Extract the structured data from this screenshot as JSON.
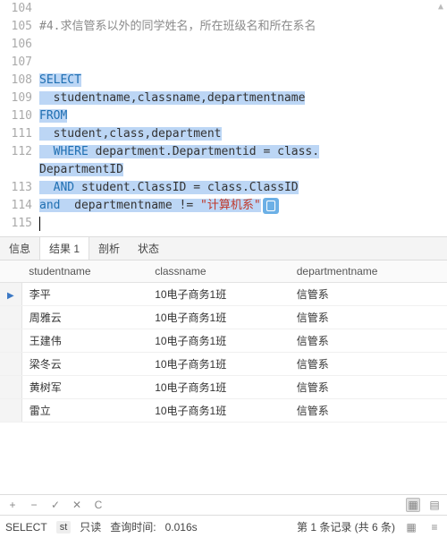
{
  "editor": {
    "lines": [
      {
        "num": "104",
        "tokens": []
      },
      {
        "num": "105",
        "tokens": [
          {
            "t": "#4.求信管系以外的同学姓名，所在班级名和所在系名",
            "cls": "comment"
          }
        ]
      },
      {
        "num": "106",
        "tokens": []
      },
      {
        "num": "107",
        "tokens": []
      },
      {
        "num": "108",
        "tokens": [
          {
            "t": "SELECT",
            "cls": "kw sel"
          }
        ]
      },
      {
        "num": "109",
        "tokens": [
          {
            "t": "  ",
            "cls": "sel"
          },
          {
            "t": "studentname,classname,departmentname",
            "cls": "sel"
          }
        ]
      },
      {
        "num": "110",
        "tokens": [
          {
            "t": "FROM",
            "cls": "kw sel"
          }
        ]
      },
      {
        "num": "111",
        "tokens": [
          {
            "t": "  ",
            "cls": "sel"
          },
          {
            "t": "student,class,department",
            "cls": "sel"
          }
        ]
      },
      {
        "num": "112",
        "tokens": [
          {
            "t": "  ",
            "cls": "sel"
          },
          {
            "t": "WHERE",
            "cls": "kw sel"
          },
          {
            "t": " department.Departmentid = class.",
            "cls": "sel"
          }
        ],
        "cont": [
          {
            "t": "DepartmentID",
            "cls": "sel"
          }
        ]
      },
      {
        "num": "113",
        "tokens": [
          {
            "t": "  ",
            "cls": "sel"
          },
          {
            "t": "AND",
            "cls": "kw sel"
          },
          {
            "t": " student.ClassID = class.ClassID",
            "cls": "sel"
          }
        ]
      },
      {
        "num": "114",
        "tokens": [
          {
            "t": "and",
            "cls": "kw sel"
          },
          {
            "t": "  departmentname != ",
            "cls": "sel"
          },
          {
            "t": "\"计算机系\"",
            "cls": "str sel"
          }
        ],
        "badge": true
      },
      {
        "num": "115",
        "tokens": [],
        "cursor": true
      }
    ]
  },
  "tabs": {
    "items": [
      "信息",
      "结果 1",
      "剖析",
      "状态"
    ],
    "active": 1
  },
  "grid": {
    "columns": [
      "studentname",
      "classname",
      "departmentname"
    ],
    "rows": [
      {
        "marker": "▶",
        "cells": [
          "李平",
          "10电子商务1班",
          "信管系"
        ]
      },
      {
        "marker": "",
        "cells": [
          "周雅云",
          "10电子商务1班",
          "信管系"
        ]
      },
      {
        "marker": "",
        "cells": [
          "王建伟",
          "10电子商务1班",
          "信管系"
        ]
      },
      {
        "marker": "",
        "cells": [
          "梁冬云",
          "10电子商务1班",
          "信管系"
        ]
      },
      {
        "marker": "",
        "cells": [
          "黄树军",
          "10电子商务1班",
          "信管系"
        ]
      },
      {
        "marker": "",
        "cells": [
          "雷立",
          "10电子商务1班",
          "信管系"
        ]
      }
    ]
  },
  "toolbar": {
    "plus": "+",
    "minus": "−",
    "check": "✓",
    "x": "✕",
    "refresh": "C"
  },
  "status": {
    "stmt": "SELECT",
    "chip": "st",
    "mode": "只读",
    "time_label": "查询时间:",
    "time_value": "0.016s",
    "record": "第 1 条记录 (共 6 条)"
  }
}
